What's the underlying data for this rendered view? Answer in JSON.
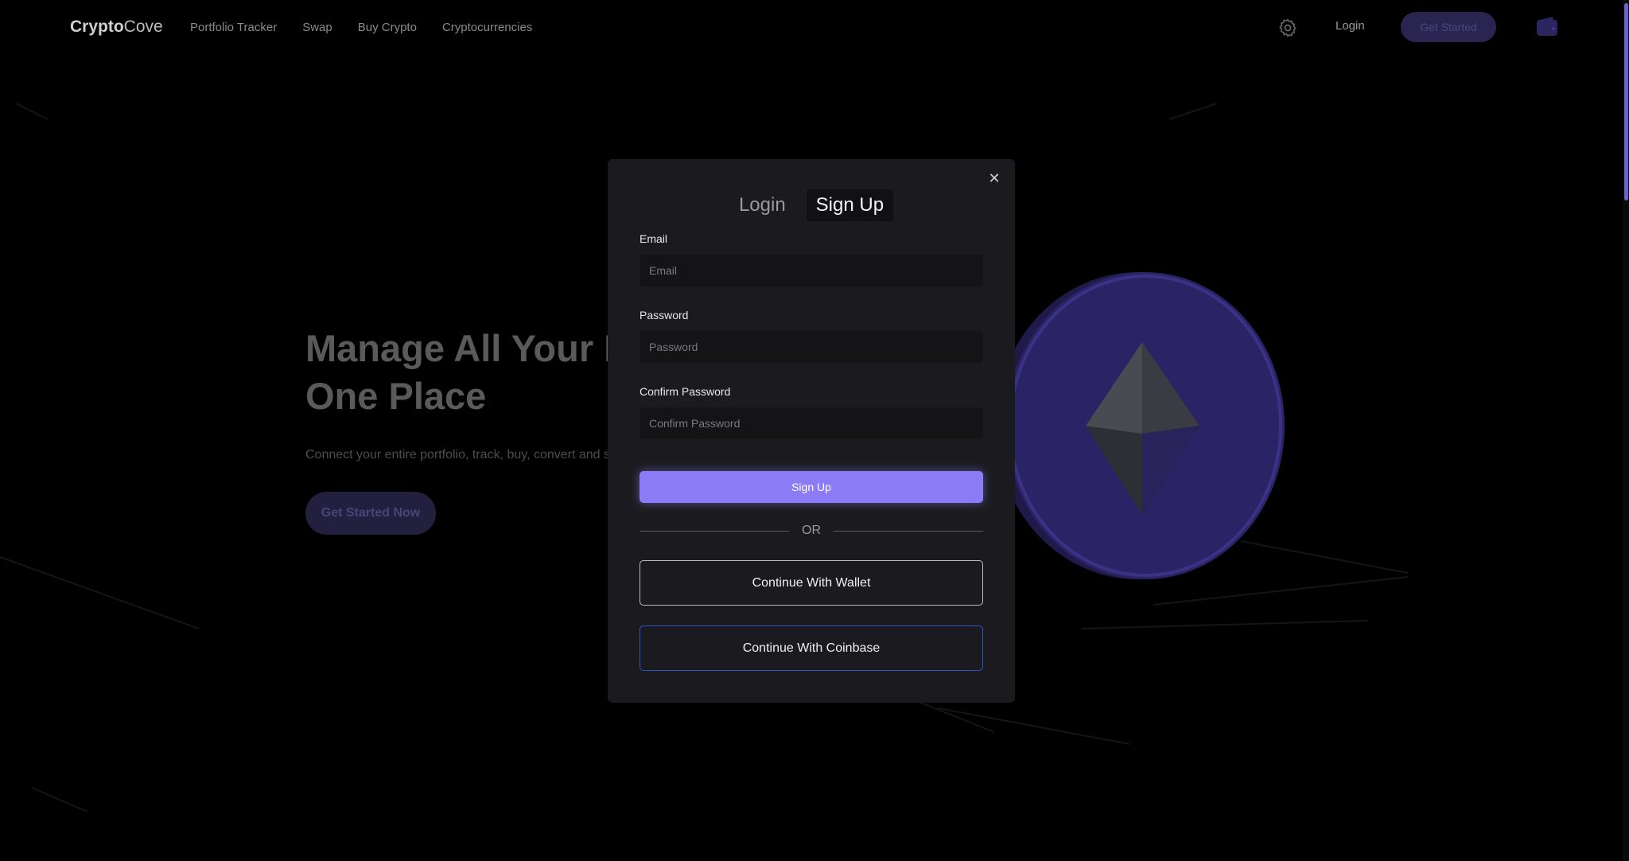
{
  "brand": {
    "bold": "Crypto",
    "light": "Cove"
  },
  "nav": {
    "links": [
      "Portfolio Tracker",
      "Swap",
      "Buy Crypto",
      "Cryptocurrencies"
    ],
    "login": "Login",
    "get_started": "Get Started"
  },
  "hero": {
    "title": "Manage All Your Di",
    "title_line2": "One Place",
    "subtitle": "Connect your entire portfolio, track, buy, convert and s",
    "cta": "Get Started Now"
  },
  "modal": {
    "tabs": [
      {
        "label": "Login",
        "active": false
      },
      {
        "label": "Sign Up",
        "active": true
      }
    ],
    "email": {
      "label": "Email",
      "placeholder": "Email",
      "value": ""
    },
    "password": {
      "label": "Password",
      "placeholder": "Password",
      "value": ""
    },
    "confirm_password": {
      "label": "Confirm Password",
      "placeholder": "Confirm Password",
      "value": ""
    },
    "submit": "Sign Up",
    "divider": "OR",
    "wallet_button": "Continue With Wallet",
    "coinbase_button": "Continue With Coinbase"
  },
  "colors": {
    "accent": "#8b7cf6",
    "modal_bg": "#1b1b1f",
    "coinbase_border": "#2f56c8",
    "coin_purple": "#2a2466"
  }
}
